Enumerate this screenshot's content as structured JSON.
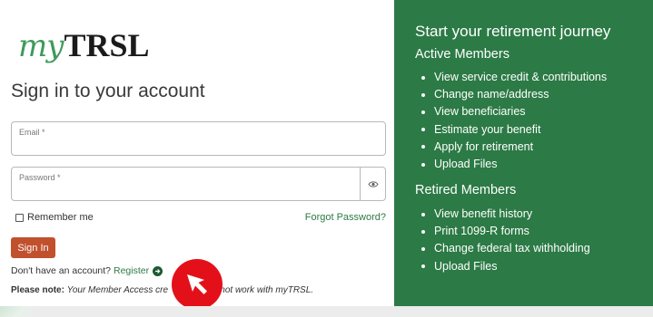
{
  "logo": {
    "my": "my",
    "brand": "TRSL"
  },
  "signin_form": {
    "title": "Sign in to your account",
    "email_label": "Email *",
    "email_value": "",
    "password_label": "Password *",
    "password_value": "",
    "remember_label": "Remember me",
    "forgot_label": "Forgot Password?",
    "signin_label": "Sign In",
    "no_account_text": "Don't have an account?",
    "register_label": "Register",
    "note_label": "Please note:",
    "note_text": "Your Member Access cre",
    "note_text_end": "ll not work with myTRSL."
  },
  "info_panel": {
    "title": "Start your retirement journey",
    "active_heading": "Active Members",
    "active_items": [
      "View service credit & contributions",
      "Change name/address",
      "View beneficiaries",
      "Estimate your benefit",
      "Apply for retirement",
      "Upload Files"
    ],
    "retired_heading": "Retired Members",
    "retired_items": [
      "View benefit history",
      "Print 1099-R forms",
      "Change federal tax withholding",
      "Upload Files"
    ]
  },
  "icons": {
    "password_toggle": "eye-icon",
    "register": "arrow-right-circle-icon",
    "cursor": "pointer-cursor-icon"
  },
  "colors": {
    "brand_green": "#2c7a45",
    "signin_button": "#c1502d",
    "cursor_highlight": "#e3101a"
  }
}
